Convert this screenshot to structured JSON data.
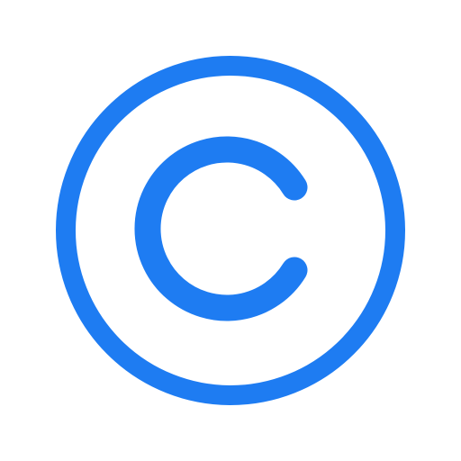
{
  "icon": {
    "name": "copyright-icon",
    "color": "#1E7CF2",
    "background": "#FFFFFF"
  }
}
